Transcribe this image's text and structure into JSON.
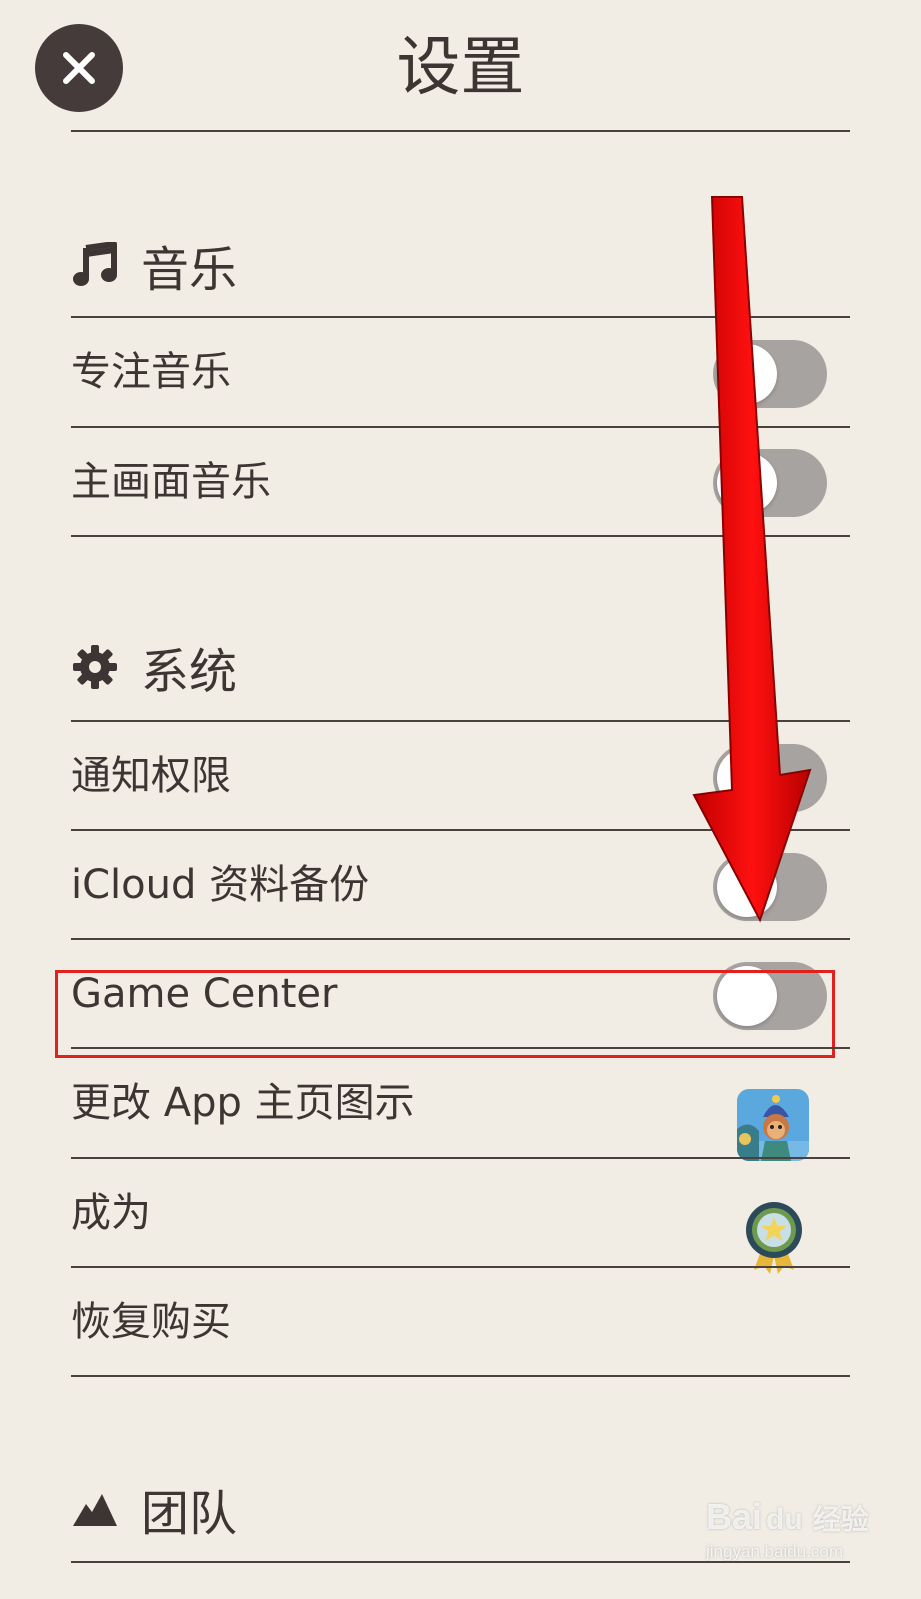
{
  "header": {
    "title": "设置",
    "close_icon": "close-icon"
  },
  "sections": {
    "music": {
      "title": "音乐",
      "icon": "music-note-icon",
      "items": [
        {
          "label": "专注音乐",
          "toggle_on": false
        },
        {
          "label": "主画面音乐",
          "toggle_on": false
        }
      ]
    },
    "system": {
      "title": "系统",
      "icon": "gear-icon",
      "items": [
        {
          "label": "通知权限",
          "toggle_on": false
        },
        {
          "label": "iCloud 资料备份",
          "toggle_on": false
        },
        {
          "label": "Game Center",
          "toggle_on": false
        },
        {
          "label": "更改 App 主页图示",
          "accessory": "app-icon"
        },
        {
          "label": "成为",
          "accessory": "badge-icon"
        },
        {
          "label": "恢复购买"
        }
      ]
    },
    "team": {
      "title": "团队",
      "icon": "mountain-icon"
    }
  },
  "annotation": {
    "highlight_color": "#e0211e",
    "arrow_color": "#ff0000"
  },
  "watermark": {
    "main": "Bai",
    "main2": "经验",
    "sub": "jingyan.baidu.com"
  },
  "colors": {
    "background": "#f1ede4",
    "text": "#3d3533",
    "toggle_off": "#a6a3a1"
  }
}
